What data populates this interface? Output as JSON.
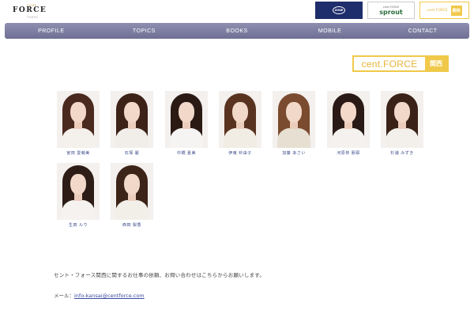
{
  "header": {
    "logo_top": "cent",
    "logo_main": "FORCE",
    "logo_sub": "TOKYO",
    "banners": {
      "zone_label": "ZONE",
      "sprout_top": "cent FORCE",
      "sprout_main": "sprout",
      "kansai_left": "cent FORCE",
      "kansai_right": "関西"
    }
  },
  "nav": {
    "items": [
      "PROFILE",
      "TOPICS",
      "BOOKS",
      "MOBILE",
      "CONTACT"
    ]
  },
  "badge": {
    "text": "cent.FORCE",
    "region": "関西"
  },
  "talents": [
    {
      "name": "宮田 愛萌美",
      "hair": "#4a2a1e",
      "body": "#f4f0ec"
    },
    {
      "name": "石塚 麗",
      "hair": "#3d2218",
      "body": "#f1eeea"
    },
    {
      "name": "中橋 夏美",
      "hair": "#2b1a14",
      "body": "#f6f4f2"
    },
    {
      "name": "伊東 紗由子",
      "hair": "#5a3320",
      "body": "#f2ede4"
    },
    {
      "name": "加藤 あさい",
      "hair": "#7a4b2e",
      "body": "#e7e0d2"
    },
    {
      "name": "河原林 朋耶",
      "hair": "#2a1a16",
      "body": "#f4f1ee"
    },
    {
      "name": "杉浦 みずき",
      "hair": "#3a2218",
      "body": "#f3f0ec"
    },
    {
      "name": "生田 ルウ",
      "hair": "#2e1c16",
      "body": "#f5f2ef"
    },
    {
      "name": "西田 梨香",
      "hair": "#3c2418",
      "body": "#f2efe9"
    }
  ],
  "footer": {
    "info_text": "セント・フォース関西に関するお仕事の依頼、お問い合わせはこちらからお願いします。",
    "mail_label": "メール：",
    "mail_address": "info-kansai@centforce.com"
  }
}
